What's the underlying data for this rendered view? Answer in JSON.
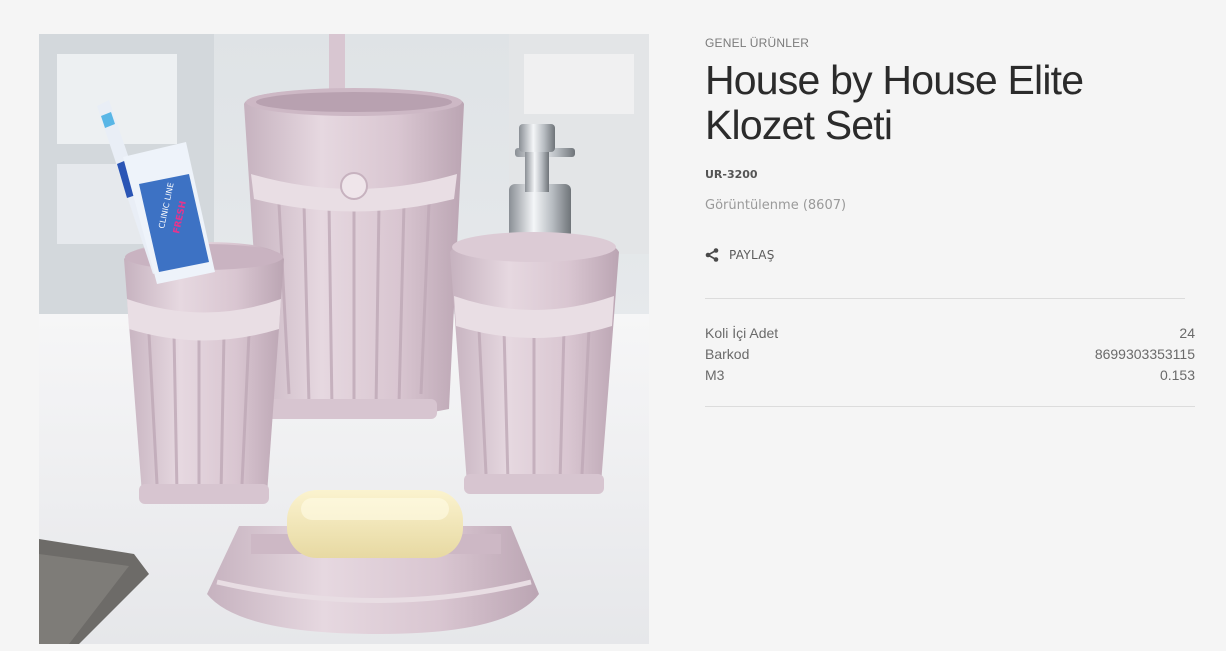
{
  "product": {
    "category": "GENEL ÜRÜNLER",
    "title": "House by House Elite Klozet Seti",
    "code": "UR-3200",
    "views": "Görüntülenme (8607)",
    "share_label": "PAYLAŞ",
    "image_alt": "House by House Elite Klozet Seti"
  },
  "specs": [
    {
      "label": "Koli İçi Adet",
      "value": "24"
    },
    {
      "label": "Barkod",
      "value": "8699303353115"
    },
    {
      "label": "M3",
      "value": "0.153"
    }
  ],
  "icons": {
    "share": "share-icon"
  },
  "colors": {
    "background": "#f5f5f5",
    "title": "#2b2b2b",
    "product": "#d9c9d2"
  },
  "image_text": {
    "toothpaste_brand": "CLINIC LINE",
    "toothpaste_type": "FRESH"
  }
}
